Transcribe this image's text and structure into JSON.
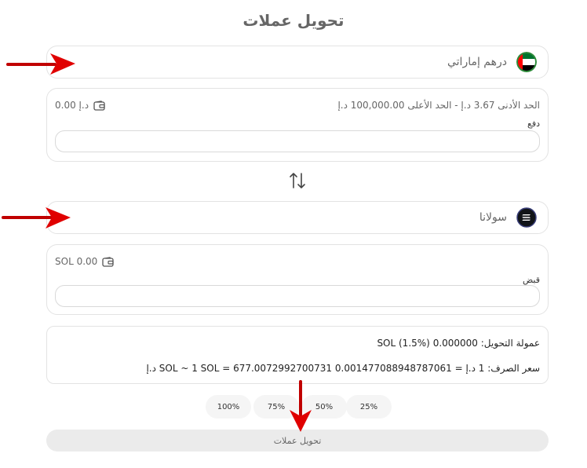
{
  "page": {
    "title": "تحويل عملات"
  },
  "from": {
    "currency_label": "درهم إماراتي",
    "icon": "uae-flag-icon",
    "balance": "0.00 د.إ",
    "limits": "الحد الأدنى 3.67 د.إ   -   الحد الأعلى 100,000.00 د.إ",
    "field_label": "دفع",
    "value": ""
  },
  "to": {
    "currency_label": "سولانا",
    "icon": "solana-icon",
    "balance": "SOL 0.00",
    "field_label": "قبض",
    "value": ""
  },
  "swap_icon": "swap-arrows-icon",
  "info": {
    "fee": "عمولة التحويل: 0.000000 SOL (1.5%)",
    "rate": "سعر الصرف: 1 د.إ = 0.001477088948787061 SOL ~ 1 SOL = 677.0072992700731 د.إ"
  },
  "percent_buttons": [
    "100%",
    "75%",
    "50%",
    "25%"
  ],
  "submit_label": "تحويل عملات",
  "colors": {
    "annotation_arrow": "#e00000",
    "button_bg": "#ebebeb",
    "border": "#e3e3e3"
  }
}
